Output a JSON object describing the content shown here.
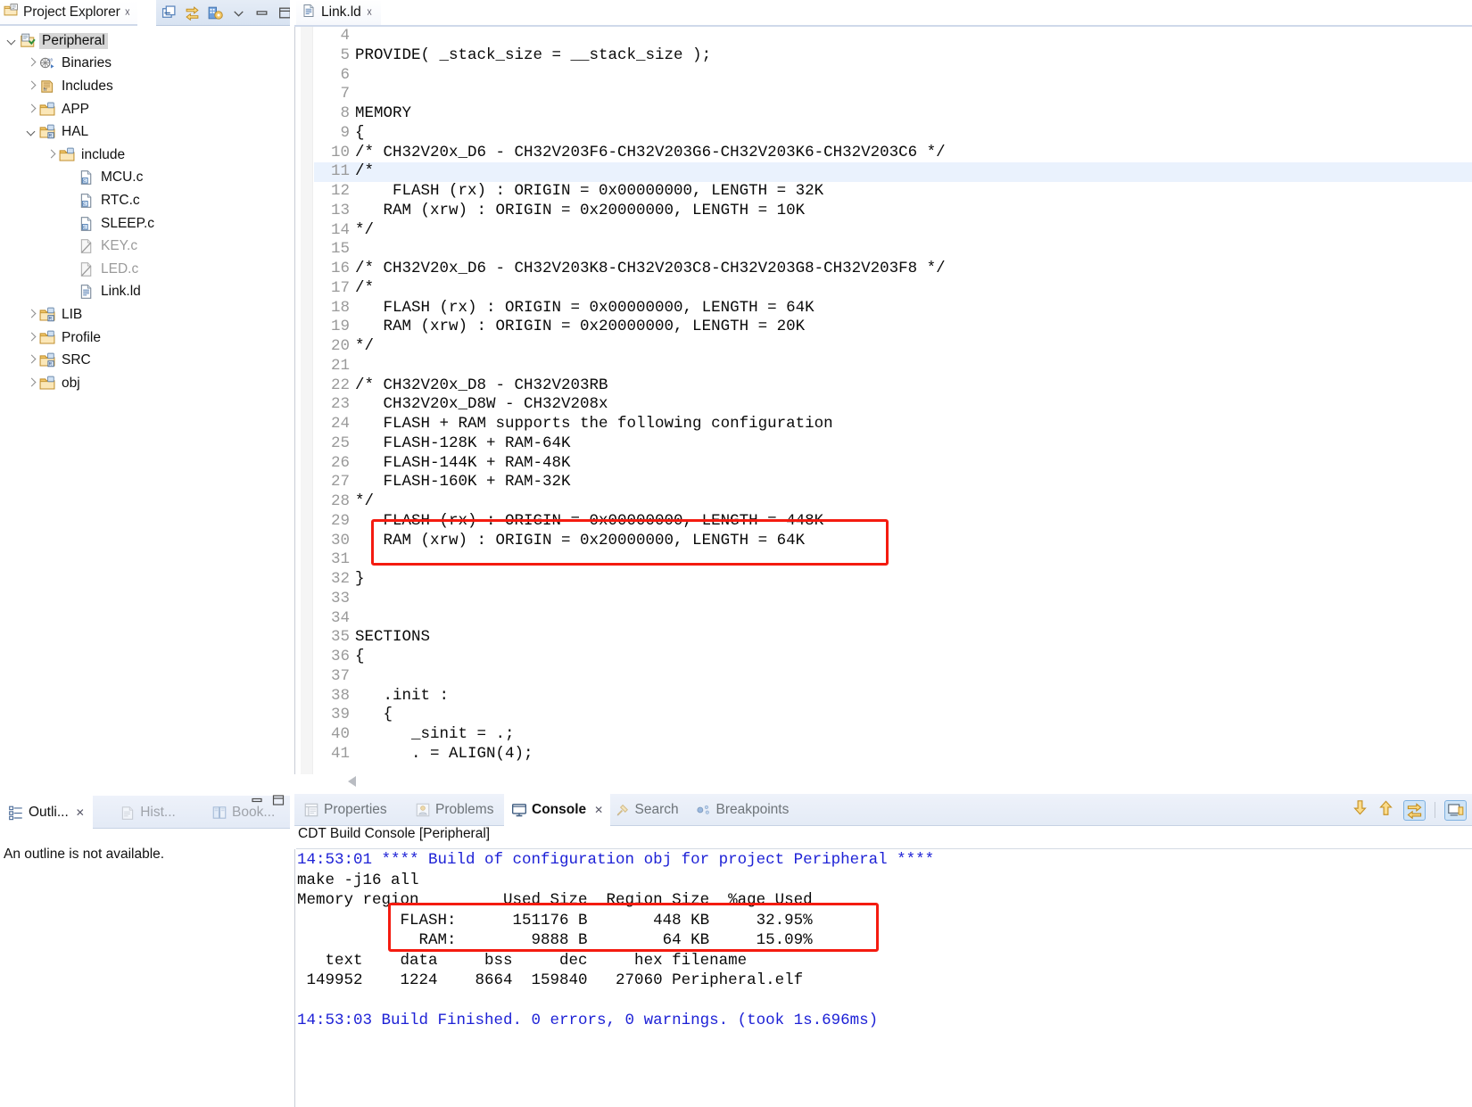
{
  "project_explorer": {
    "tab_label": "Project Explorer",
    "close_icon": "close-icon",
    "toolbar": [
      {
        "name": "collapse-all-icon"
      },
      {
        "name": "link-with-editor-icon"
      },
      {
        "name": "view-menu-build-icon"
      },
      {
        "name": "view-menu-icon"
      },
      {
        "name": "minimize-icon"
      },
      {
        "name": "maximize-icon"
      }
    ],
    "tree": [
      {
        "label": "Peripheral",
        "indent": 0,
        "twist": "expanded",
        "icon": "project-icon",
        "selected": true,
        "dim": false
      },
      {
        "label": "Binaries",
        "indent": 1,
        "twist": "collapsed",
        "icon": "binaries-icon",
        "selected": false,
        "dim": false
      },
      {
        "label": "Includes",
        "indent": 1,
        "twist": "collapsed",
        "icon": "includes-icon",
        "selected": false,
        "dim": false
      },
      {
        "label": "APP",
        "indent": 1,
        "twist": "collapsed",
        "icon": "folder-icon",
        "selected": false,
        "dim": false
      },
      {
        "label": "HAL",
        "indent": 1,
        "twist": "expanded",
        "icon": "source-folder-icon",
        "selected": false,
        "dim": false
      },
      {
        "label": "include",
        "indent": 2,
        "twist": "collapsed",
        "icon": "folder-icon",
        "selected": false,
        "dim": false
      },
      {
        "label": "MCU.c",
        "indent": 3,
        "twist": "none",
        "icon": "c-file-icon",
        "selected": false,
        "dim": false
      },
      {
        "label": "RTC.c",
        "indent": 3,
        "twist": "none",
        "icon": "c-file-icon",
        "selected": false,
        "dim": false
      },
      {
        "label": "SLEEP.c",
        "indent": 3,
        "twist": "none",
        "icon": "c-file-icon",
        "selected": false,
        "dim": false
      },
      {
        "label": "KEY.c",
        "indent": 3,
        "twist": "none",
        "icon": "excluded-file-icon",
        "selected": false,
        "dim": true
      },
      {
        "label": "LED.c",
        "indent": 3,
        "twist": "none",
        "icon": "excluded-file-icon",
        "selected": false,
        "dim": true
      },
      {
        "label": "Link.ld",
        "indent": 3,
        "twist": "none",
        "icon": "text-file-icon",
        "selected": false,
        "dim": false
      },
      {
        "label": "LIB",
        "indent": 1,
        "twist": "collapsed",
        "icon": "source-folder-icon",
        "selected": false,
        "dim": false
      },
      {
        "label": "Profile",
        "indent": 1,
        "twist": "collapsed",
        "icon": "folder-icon",
        "selected": false,
        "dim": false
      },
      {
        "label": "SRC",
        "indent": 1,
        "twist": "collapsed",
        "icon": "source-folder-icon",
        "selected": false,
        "dim": false
      },
      {
        "label": "obj",
        "indent": 1,
        "twist": "collapsed",
        "icon": "folder-icon",
        "selected": false,
        "dim": false
      }
    ]
  },
  "outline_view": {
    "tabs": [
      {
        "label": "Outli...",
        "icon": "outline-icon",
        "active": true,
        "close": true
      },
      {
        "label": "Hist...",
        "icon": "history-icon",
        "active": false,
        "close": false
      },
      {
        "label": "Book...",
        "icon": "bookmarks-icon",
        "active": false,
        "close": false
      }
    ],
    "controls": [
      {
        "name": "minimize-icon"
      },
      {
        "name": "maximize-icon"
      }
    ],
    "message": "An outline is not available."
  },
  "editor": {
    "tab": {
      "label": "Link.ld",
      "icon": "text-file-icon",
      "close_icon": "close-icon"
    },
    "first_line_number": 4,
    "highlighted_line": 11,
    "lines": [
      {
        "n": 4,
        "text": ""
      },
      {
        "n": 5,
        "text": "PROVIDE( _stack_size = __stack_size );"
      },
      {
        "n": 6,
        "text": ""
      },
      {
        "n": 7,
        "text": ""
      },
      {
        "n": 8,
        "text": "MEMORY"
      },
      {
        "n": 9,
        "text": "{"
      },
      {
        "n": 10,
        "text": "/* CH32V20x_D6 - CH32V203F6-CH32V203G6-CH32V203K6-CH32V203C6 */"
      },
      {
        "n": 11,
        "text": "/*"
      },
      {
        "n": 12,
        "text": "    FLASH (rx) : ORIGIN = 0x00000000, LENGTH = 32K"
      },
      {
        "n": 13,
        "text": "   RAM (xrw) : ORIGIN = 0x20000000, LENGTH = 10K"
      },
      {
        "n": 14,
        "text": "*/"
      },
      {
        "n": 15,
        "text": ""
      },
      {
        "n": 16,
        "text": "/* CH32V20x_D6 - CH32V203K8-CH32V203C8-CH32V203G8-CH32V203F8 */"
      },
      {
        "n": 17,
        "text": "/*"
      },
      {
        "n": 18,
        "text": "   FLASH (rx) : ORIGIN = 0x00000000, LENGTH = 64K"
      },
      {
        "n": 19,
        "text": "   RAM (xrw) : ORIGIN = 0x20000000, LENGTH = 20K"
      },
      {
        "n": 20,
        "text": "*/"
      },
      {
        "n": 21,
        "text": ""
      },
      {
        "n": 22,
        "text": "/* CH32V20x_D8 - CH32V203RB"
      },
      {
        "n": 23,
        "text": "   CH32V20x_D8W - CH32V208x"
      },
      {
        "n": 24,
        "text": "   FLASH + RAM supports the following configuration"
      },
      {
        "n": 25,
        "text": "   FLASH-128K + RAM-64K"
      },
      {
        "n": 26,
        "text": "   FLASH-144K + RAM-48K"
      },
      {
        "n": 27,
        "text": "   FLASH-160K + RAM-32K"
      },
      {
        "n": 28,
        "text": "*/"
      },
      {
        "n": 29,
        "text": "   FLASH (rx) : ORIGIN = 0x00000000, LENGTH = 448K"
      },
      {
        "n": 30,
        "text": "   RAM (xrw) : ORIGIN = 0x20000000, LENGTH = 64K"
      },
      {
        "n": 31,
        "text": ""
      },
      {
        "n": 32,
        "text": "}"
      },
      {
        "n": 33,
        "text": ""
      },
      {
        "n": 34,
        "text": ""
      },
      {
        "n": 35,
        "text": "SECTIONS"
      },
      {
        "n": 36,
        "text": "{"
      },
      {
        "n": 37,
        "text": ""
      },
      {
        "n": 38,
        "text": "   .init :"
      },
      {
        "n": 39,
        "text": "   {"
      },
      {
        "n": 40,
        "text": "      _sinit = .;"
      },
      {
        "n": 41,
        "text": "      . = ALIGN(4);"
      }
    ],
    "annotation_box_color": "#f41b10",
    "scroll_left_arrow": "scroll-left-arrow-icon"
  },
  "bottom_panel": {
    "tabs": [
      {
        "label": "Properties",
        "icon": "properties-icon",
        "active": false,
        "close": false
      },
      {
        "label": "Problems",
        "icon": "problems-icon",
        "active": false,
        "close": false
      },
      {
        "label": "Console",
        "icon": "console-icon",
        "active": true,
        "close": true
      },
      {
        "label": "Search",
        "icon": "search-icon",
        "active": false,
        "close": false
      },
      {
        "label": "Breakpoints",
        "icon": "breakpoints-icon",
        "active": false,
        "close": false
      }
    ],
    "toolbar": [
      {
        "name": "scroll-down-icon"
      },
      {
        "name": "scroll-up-icon"
      },
      {
        "name": "pin-console-icon"
      },
      {
        "name": "display-selected-console-icon"
      }
    ],
    "console_title": "CDT Build Console [Peripheral]",
    "console_lines": [
      {
        "text": "14:53:01 **** Build of configuration obj for project Peripheral ****",
        "blue": true
      },
      {
        "text": "make -j16 all",
        "blue": false
      },
      {
        "text": "Memory region         Used Size  Region Size  %age Used",
        "blue": false
      },
      {
        "text": "           FLASH:      151176 B       448 KB     32.95%",
        "blue": false
      },
      {
        "text": "             RAM:        9888 B        64 KB     15.09%",
        "blue": false
      },
      {
        "text": "   text    data     bss     dec     hex filename",
        "blue": false
      },
      {
        "text": " 149952    1224    8664  159840   27060 Peripheral.elf",
        "blue": false
      },
      {
        "text": "",
        "blue": false
      },
      {
        "text": "14:53:03 Build Finished. 0 errors, 0 warnings. (took 1s.696ms)",
        "blue": true
      }
    ]
  }
}
